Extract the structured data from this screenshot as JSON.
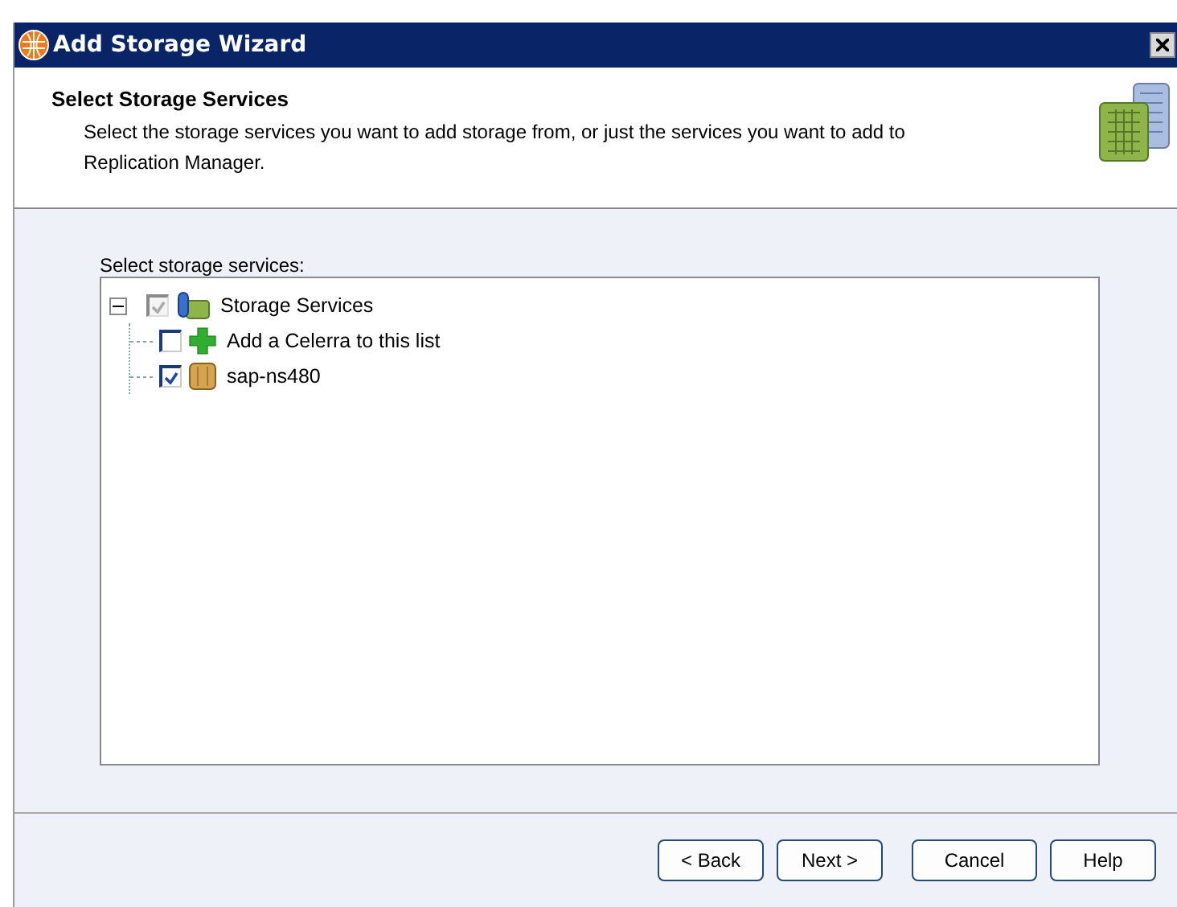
{
  "window": {
    "title": "Add Storage Wizard"
  },
  "header": {
    "title": "Select Storage Services",
    "description": "Select the storage services you want to add storage from, or just the services you want to add to Replication Manager."
  },
  "tree": {
    "label": "Select storage services:",
    "root": {
      "label": "Storage Services",
      "expanded": true,
      "checked": true,
      "disabled": true,
      "kind": "services",
      "children": [
        {
          "label": "Add a Celerra to this list",
          "checked": false,
          "disabled": false,
          "kind": "add"
        },
        {
          "label": "sap-ns480",
          "checked": true,
          "disabled": false,
          "kind": "storage"
        }
      ]
    }
  },
  "buttons": [
    "< Back",
    "Next >",
    "Cancel",
    "Help"
  ]
}
